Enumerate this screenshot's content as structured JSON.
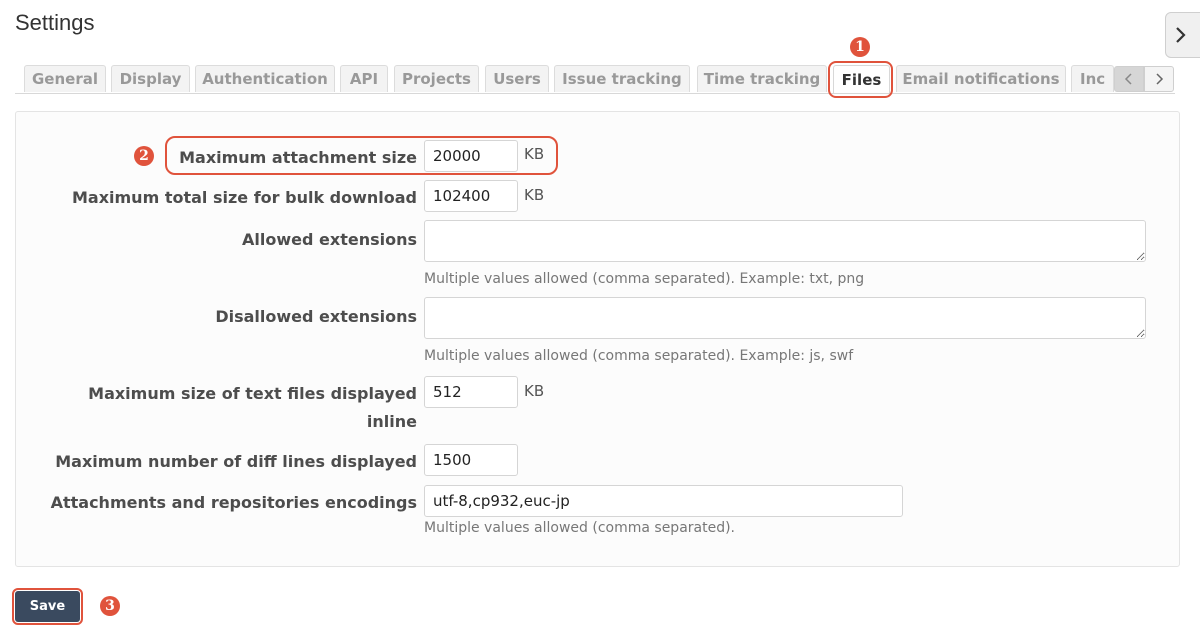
{
  "page": {
    "title": "Settings"
  },
  "tabs": [
    {
      "label": "General"
    },
    {
      "label": "Display"
    },
    {
      "label": "Authentication"
    },
    {
      "label": "API"
    },
    {
      "label": "Projects"
    },
    {
      "label": "Users"
    },
    {
      "label": "Issue tracking"
    },
    {
      "label": "Time tracking"
    },
    {
      "label": "Files",
      "active": true
    },
    {
      "label": "Email notifications"
    },
    {
      "label": "Inc"
    }
  ],
  "callouts": [
    "1",
    "2",
    "3"
  ],
  "form": {
    "max_attachment_size": {
      "label": "Maximum attachment size",
      "value": "20000",
      "unit": "KB"
    },
    "max_bulk_download": {
      "label": "Maximum total size for bulk download",
      "value": "102400",
      "unit": "KB"
    },
    "allowed_extensions": {
      "label": "Allowed extensions",
      "value": "",
      "hint": "Multiple values allowed (comma separated). Example: txt, png"
    },
    "disallowed_extensions": {
      "label": "Disallowed extensions",
      "value": "",
      "hint": "Multiple values allowed (comma separated). Example: js, swf"
    },
    "max_text_inline": {
      "label_line1": "Maximum size of text files displayed",
      "label_line2": "inline",
      "value": "512",
      "unit": "KB"
    },
    "max_diff_lines": {
      "label": "Maximum number of diff lines displayed",
      "value": "1500"
    },
    "encodings": {
      "label": "Attachments and repositories encodings",
      "value": "utf-8,cp932,euc-jp",
      "hint": "Multiple values allowed (comma separated)."
    }
  },
  "actions": {
    "save_label": "Save"
  },
  "colors": {
    "accent": "#e0533c",
    "save_button": "#3a4a5f"
  },
  "icons": {
    "collapse": "chevron-right-icon",
    "tab_scroll_left": "chevron-left-icon",
    "tab_scroll_right": "chevron-right-icon"
  }
}
